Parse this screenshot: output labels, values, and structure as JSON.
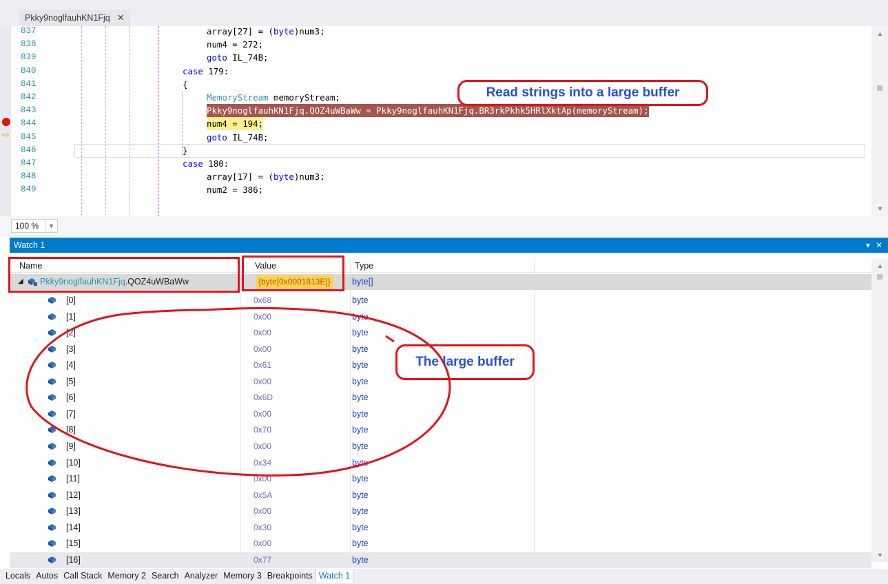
{
  "document_tab": {
    "title": "Pkky9noglfauhKN1Fjq",
    "close_glyph": "✕"
  },
  "editor": {
    "lines": [
      {
        "num": "837",
        "code": "array[27] = (byte)num3;"
      },
      {
        "num": "838",
        "code": "num4 = 272;"
      },
      {
        "num": "839",
        "code": "goto IL_74B;"
      },
      {
        "num": "840",
        "code": "case 179:"
      },
      {
        "num": "841",
        "code": "{"
      },
      {
        "num": "842",
        "code": "MemoryStream memoryStream;"
      },
      {
        "num": "843",
        "code": "Pkky9noglfauhKN1Fjq.QOZ4uWBaWw = Pkky9noglfauhKN1Fjq.BR3rkPkhk5HRlXktAp(memoryStream);"
      },
      {
        "num": "844",
        "code": "num4 = 194;"
      },
      {
        "num": "845",
        "code": "goto IL_74B;"
      },
      {
        "num": "846",
        "code": "}"
      },
      {
        "num": "847",
        "code": "case 180:"
      },
      {
        "num": "848",
        "code": "array[17] = (byte)num3;"
      },
      {
        "num": "849",
        "code": "num2 = 386;"
      }
    ],
    "breakpoint_line": "843",
    "current_line": "844",
    "annotation": "Read strings into a large buffer",
    "zoom": "100 %"
  },
  "watch": {
    "title": "Watch 1",
    "title_buttons": [
      "▾",
      "✕"
    ],
    "headers": {
      "name": "Name",
      "value": "Value",
      "type": "Type"
    },
    "root": {
      "expander": "◢",
      "class_name": "Pkky9noglfauhKN1Fjq",
      "member": ".QOZ4uWBaWw",
      "value": "{byte[0x0001813E]}",
      "type": "byte[]"
    },
    "items": [
      {
        "name": "[0]",
        "value": "0x68",
        "type": "byte"
      },
      {
        "name": "[1]",
        "value": "0x00",
        "type": "byte"
      },
      {
        "name": "[2]",
        "value": "0x00",
        "type": "byte"
      },
      {
        "name": "[3]",
        "value": "0x00",
        "type": "byte"
      },
      {
        "name": "[4]",
        "value": "0x61",
        "type": "byte"
      },
      {
        "name": "[5]",
        "value": "0x00",
        "type": "byte"
      },
      {
        "name": "[6]",
        "value": "0x6D",
        "type": "byte"
      },
      {
        "name": "[7]",
        "value": "0x00",
        "type": "byte"
      },
      {
        "name": "[8]",
        "value": "0x70",
        "type": "byte"
      },
      {
        "name": "[9]",
        "value": "0x00",
        "type": "byte"
      },
      {
        "name": "[10]",
        "value": "0x34",
        "type": "byte"
      },
      {
        "name": "[11]",
        "value": "0x00",
        "type": "byte"
      },
      {
        "name": "[12]",
        "value": "0x5A",
        "type": "byte"
      },
      {
        "name": "[13]",
        "value": "0x00",
        "type": "byte"
      },
      {
        "name": "[14]",
        "value": "0x30",
        "type": "byte"
      },
      {
        "name": "[15]",
        "value": "0x00",
        "type": "byte"
      },
      {
        "name": "[16]",
        "value": "0x77",
        "type": "byte"
      }
    ],
    "annotation": "The large buffer"
  },
  "bottom_tabs": [
    "Locals",
    "Autos",
    "Call Stack",
    "Memory 2",
    "Search",
    "Analyzer",
    "Memory 3",
    "Breakpoints",
    "Watch 1"
  ],
  "active_bottom_tab": "Watch 1",
  "colors": {
    "accent": "#007acc",
    "breakpoint": "#e51400",
    "breakpoint_line_bg": "#a4564f",
    "current_line_bg": "#ffef8f",
    "annotation_red": "#e0141c",
    "annotation_text": "#2a4fd6"
  }
}
